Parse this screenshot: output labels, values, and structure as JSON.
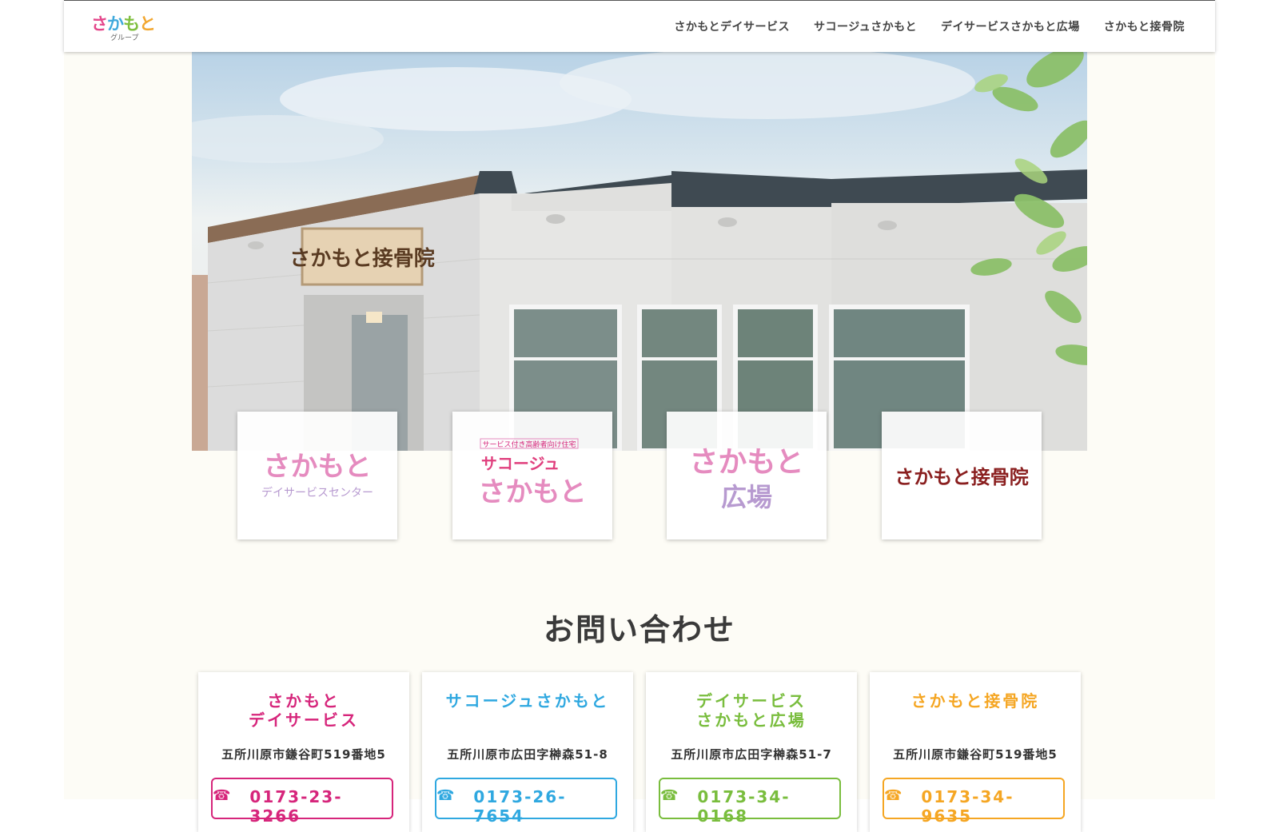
{
  "header": {
    "logo_text": "さかもと",
    "logo_sub": "グループ",
    "nav": [
      {
        "label": "さかもとデイサービス"
      },
      {
        "label": "サコージュさかもと"
      },
      {
        "label": "デイサービスさかもと広場"
      },
      {
        "label": "さかもと接骨院"
      }
    ]
  },
  "hero": {
    "sign_text": "さかもと接骨院"
  },
  "facilities": [
    {
      "logo_main": "さかもと",
      "logo_sub": "デイサービスセンター"
    },
    {
      "logo_tag": "サービス付き高齢者向け住宅",
      "logo_top": "サコージュ",
      "logo_main": "さかもと"
    },
    {
      "logo_main": "さかもと",
      "logo_sub": "広場"
    },
    {
      "logo_main": "さかもと接骨院"
    }
  ],
  "contact": {
    "title": "お問い合わせ",
    "cards": [
      {
        "name": "さかもと\nデイサービス",
        "address": "五所川原市鎌谷町519番地5",
        "phone": "0173-23-3266",
        "color": "#d6257b"
      },
      {
        "name": "サコージュさかもと",
        "address": "五所川原市広田字榊森51-8",
        "phone": "0173-26-7654",
        "color": "#2fa8e0"
      },
      {
        "name": "デイサービス\nさかもと広場",
        "address": "五所川原市広田字榊森51-7",
        "phone": "0173-34-0168",
        "color": "#79bd3d"
      },
      {
        "name": "さかもと接骨院",
        "address": "五所川原市鎌谷町519番地5",
        "phone": "0173-34-9635",
        "color": "#f5a623"
      }
    ]
  }
}
